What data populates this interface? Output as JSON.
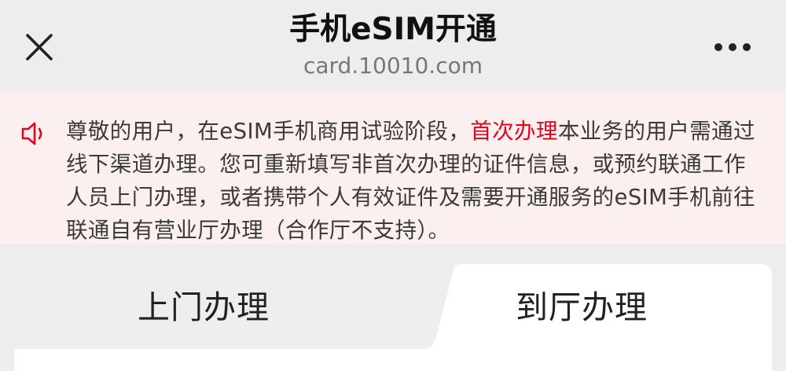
{
  "header": {
    "title": "手机eSIM开通",
    "domain": "card.10010.com",
    "close_icon": "close-icon",
    "more_icon": "more-dots-icon"
  },
  "notice": {
    "icon": "speaker-icon",
    "text_before": "尊敬的用户，在eSIM手机商用试验阶段，",
    "highlight": "首次办理",
    "text_after": "本业务的用户需通过线下渠道办理。您可重新填写非首次办理的证件信息，或预约联通工作人员上门办理，或者携带个人有效证件及需要开通服务的eSIM手机前往联通自有营业厅办理（合作厅不支持）。",
    "highlight_color": "#e1061e"
  },
  "tabs": [
    {
      "label": "上门办理",
      "selected": false
    },
    {
      "label": "到厅办理",
      "selected": true
    }
  ]
}
